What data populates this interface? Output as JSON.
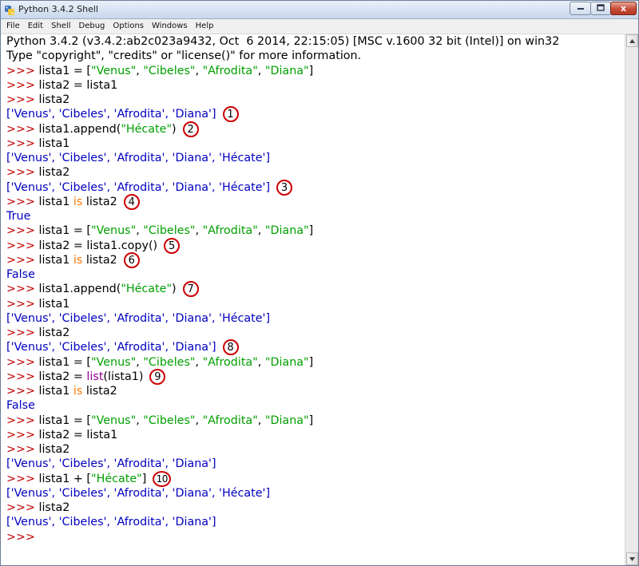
{
  "window": {
    "title": "Python 3.4.2 Shell",
    "close_glyph": "x"
  },
  "menu": [
    "File",
    "Edit",
    "Shell",
    "Debug",
    "Options",
    "Windows",
    "Help"
  ],
  "shell": {
    "banner": [
      "Python 3.4.2 (v3.4.2:ab2c023a9432, Oct  6 2014, 22:15:05) [MSC v.1600 32 bit (Intel)] on win32",
      "Type \"copyright\", \"credits\" or \"license()\" for more information."
    ],
    "prompt": ">>> ",
    "lines": [
      {
        "kind": "in",
        "segments": [
          {
            "t": "lista1 = ["
          },
          {
            "t": "\"Venus\"",
            "c": "str"
          },
          {
            "t": ", "
          },
          {
            "t": "\"Cibeles\"",
            "c": "str"
          },
          {
            "t": ", "
          },
          {
            "t": "\"Afrodita\"",
            "c": "str"
          },
          {
            "t": ", "
          },
          {
            "t": "\"Diana\"",
            "c": "str"
          },
          {
            "t": "]"
          }
        ]
      },
      {
        "kind": "in",
        "segments": [
          {
            "t": "lista2 = lista1"
          }
        ]
      },
      {
        "kind": "in",
        "segments": [
          {
            "t": "lista2"
          }
        ]
      },
      {
        "kind": "out",
        "segments": [
          {
            "t": "['Venus', 'Cibeles', 'Afrodita', 'Diana']"
          }
        ],
        "badge": "1"
      },
      {
        "kind": "in",
        "segments": [
          {
            "t": "lista1.append("
          },
          {
            "t": "\"Hécate\"",
            "c": "str"
          },
          {
            "t": ")"
          }
        ],
        "badge": "2"
      },
      {
        "kind": "in",
        "segments": [
          {
            "t": "lista1"
          }
        ]
      },
      {
        "kind": "out",
        "segments": [
          {
            "t": "['Venus', 'Cibeles', 'Afrodita', 'Diana', 'Hécate']"
          }
        ]
      },
      {
        "kind": "in",
        "segments": [
          {
            "t": "lista2"
          }
        ]
      },
      {
        "kind": "out",
        "segments": [
          {
            "t": "['Venus', 'Cibeles', 'Afrodita', 'Diana', 'Hécate']"
          }
        ],
        "badge": "3"
      },
      {
        "kind": "in",
        "segments": [
          {
            "t": "lista1 "
          },
          {
            "t": "is",
            "c": "kw"
          },
          {
            "t": " lista2"
          }
        ],
        "badge": "4"
      },
      {
        "kind": "out",
        "segments": [
          {
            "t": "True"
          }
        ]
      },
      {
        "kind": "in",
        "segments": [
          {
            "t": "lista1 = ["
          },
          {
            "t": "\"Venus\"",
            "c": "str"
          },
          {
            "t": ", "
          },
          {
            "t": "\"Cibeles\"",
            "c": "str"
          },
          {
            "t": ", "
          },
          {
            "t": "\"Afrodita\"",
            "c": "str"
          },
          {
            "t": ", "
          },
          {
            "t": "\"Diana\"",
            "c": "str"
          },
          {
            "t": "]"
          }
        ]
      },
      {
        "kind": "in",
        "segments": [
          {
            "t": "lista2 = lista1.copy()"
          }
        ],
        "badge": "5"
      },
      {
        "kind": "in",
        "segments": [
          {
            "t": "lista1 "
          },
          {
            "t": "is",
            "c": "kw"
          },
          {
            "t": " lista2"
          }
        ],
        "badge": "6"
      },
      {
        "kind": "out",
        "segments": [
          {
            "t": "False"
          }
        ]
      },
      {
        "kind": "in",
        "segments": [
          {
            "t": "lista1.append("
          },
          {
            "t": "\"Hécate\"",
            "c": "str"
          },
          {
            "t": ")"
          }
        ],
        "badge": "7"
      },
      {
        "kind": "in",
        "segments": [
          {
            "t": "lista1"
          }
        ]
      },
      {
        "kind": "out",
        "segments": [
          {
            "t": "['Venus', 'Cibeles', 'Afrodita', 'Diana', 'Hécate']"
          }
        ]
      },
      {
        "kind": "in",
        "segments": [
          {
            "t": "lista2"
          }
        ]
      },
      {
        "kind": "out",
        "segments": [
          {
            "t": "['Venus', 'Cibeles', 'Afrodita', 'Diana']"
          }
        ],
        "badge": "8"
      },
      {
        "kind": "in",
        "segments": [
          {
            "t": "lista1 = ["
          },
          {
            "t": "\"Venus\"",
            "c": "str"
          },
          {
            "t": ", "
          },
          {
            "t": "\"Cibeles\"",
            "c": "str"
          },
          {
            "t": ", "
          },
          {
            "t": "\"Afrodita\"",
            "c": "str"
          },
          {
            "t": ", "
          },
          {
            "t": "\"Diana\"",
            "c": "str"
          },
          {
            "t": "]"
          }
        ]
      },
      {
        "kind": "in",
        "segments": [
          {
            "t": "lista2 = "
          },
          {
            "t": "list",
            "c": "bi"
          },
          {
            "t": "(lista1)"
          }
        ],
        "badge": "9"
      },
      {
        "kind": "in",
        "segments": [
          {
            "t": "lista1 "
          },
          {
            "t": "is",
            "c": "kw"
          },
          {
            "t": " lista2"
          }
        ]
      },
      {
        "kind": "out",
        "segments": [
          {
            "t": "False"
          }
        ]
      },
      {
        "kind": "in",
        "segments": [
          {
            "t": "lista1 = ["
          },
          {
            "t": "\"Venus\"",
            "c": "str"
          },
          {
            "t": ", "
          },
          {
            "t": "\"Cibeles\"",
            "c": "str"
          },
          {
            "t": ", "
          },
          {
            "t": "\"Afrodita\"",
            "c": "str"
          },
          {
            "t": ", "
          },
          {
            "t": "\"Diana\"",
            "c": "str"
          },
          {
            "t": "]"
          }
        ]
      },
      {
        "kind": "in",
        "segments": [
          {
            "t": "lista2 = lista1"
          }
        ]
      },
      {
        "kind": "in",
        "segments": [
          {
            "t": "lista2"
          }
        ]
      },
      {
        "kind": "out",
        "segments": [
          {
            "t": "['Venus', 'Cibeles', 'Afrodita', 'Diana']"
          }
        ]
      },
      {
        "kind": "in",
        "segments": [
          {
            "t": "lista1 + ["
          },
          {
            "t": "\"Hécate\"",
            "c": "str"
          },
          {
            "t": "]"
          }
        ],
        "badge": "10"
      },
      {
        "kind": "out",
        "segments": [
          {
            "t": "['Venus', 'Cibeles', 'Afrodita', 'Diana', 'Hécate']"
          }
        ]
      },
      {
        "kind": "in",
        "segments": [
          {
            "t": "lista2"
          }
        ]
      },
      {
        "kind": "out",
        "segments": [
          {
            "t": "['Venus', 'Cibeles', 'Afrodita', 'Diana']"
          }
        ]
      },
      {
        "kind": "in",
        "segments": []
      }
    ]
  },
  "colors": {
    "prompt": "#c00000",
    "string": "#00a000",
    "keyword": "#ff7700",
    "builtin": "#900090",
    "output": "#0000c0",
    "badge_ring": "#cc0000"
  },
  "icons": {
    "app": "python-idle-icon",
    "minimize": "minimize-icon",
    "maximize": "maximize-icon",
    "close": "close-icon",
    "scroll_up": "scroll-up-arrow-icon",
    "scroll_down": "scroll-down-arrow-icon"
  }
}
